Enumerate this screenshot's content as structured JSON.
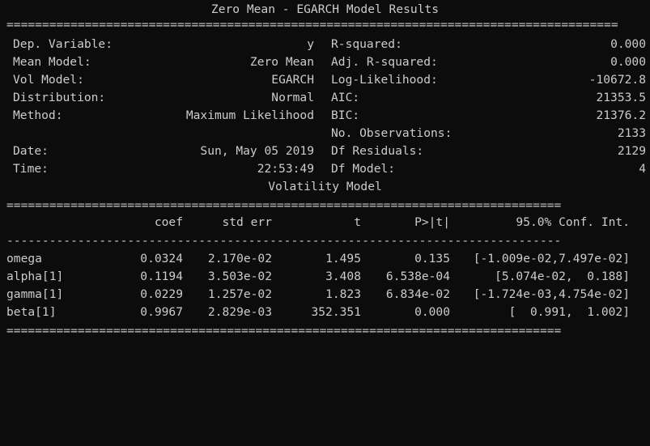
{
  "title": "Zero Mean - EGARCH Model Results",
  "rule_double": "======================================================================================",
  "rule_double_short": "==============================================================================",
  "rule_single": "------------------------------------------------------------------------------",
  "summary_left": [
    {
      "label": "Dep. Variable:",
      "value": "y"
    },
    {
      "label": "Mean Model:",
      "value": "Zero Mean"
    },
    {
      "label": "Vol Model:",
      "value": "EGARCH"
    },
    {
      "label": "Distribution:",
      "value": "Normal"
    },
    {
      "label": "Method:",
      "value": "Maximum Likelihood"
    },
    {
      "label": "",
      "value": ""
    },
    {
      "label": "Date:",
      "value": "Sun, May 05 2019"
    },
    {
      "label": "Time:",
      "value": "22:53:49"
    }
  ],
  "summary_right": [
    {
      "label": "R-squared:",
      "value": "0.000"
    },
    {
      "label": "Adj. R-squared:",
      "value": "0.000"
    },
    {
      "label": "Log-Likelihood:",
      "value": "-10672.8"
    },
    {
      "label": "AIC:",
      "value": "21353.5"
    },
    {
      "label": "BIC:",
      "value": "21376.2"
    },
    {
      "label": "No. Observations:",
      "value": "2133"
    },
    {
      "label": "Df Residuals:",
      "value": "2129"
    },
    {
      "label": "Df Model:",
      "value": "4"
    }
  ],
  "section_title": "Volatility Model",
  "columns": [
    "coef",
    "std err",
    "t",
    "P>|t|",
    "95.0% Conf. Int."
  ],
  "rows": [
    {
      "name": "omega",
      "coef": "0.0324",
      "std_err": "2.170e-02",
      "t": "1.495",
      "p": "0.135",
      "ci": "[-1.009e-02,7.497e-02]"
    },
    {
      "name": "alpha[1]",
      "coef": "0.1194",
      "std_err": "3.503e-02",
      "t": "3.408",
      "p": "6.538e-04",
      "ci": "[5.074e-02,  0.188]"
    },
    {
      "name": "gamma[1]",
      "coef": "0.0229",
      "std_err": "1.257e-02",
      "t": "1.823",
      "p": "6.834e-02",
      "ci": "[-1.724e-03,4.754e-02]"
    },
    {
      "name": "beta[1]",
      "coef": "0.9967",
      "std_err": "2.829e-03",
      "t": "352.351",
      "p": "0.000",
      "ci": "[  0.991,  1.002]"
    }
  ],
  "colors": {
    "background": "#0c0c0c",
    "text": "#cccccc"
  }
}
